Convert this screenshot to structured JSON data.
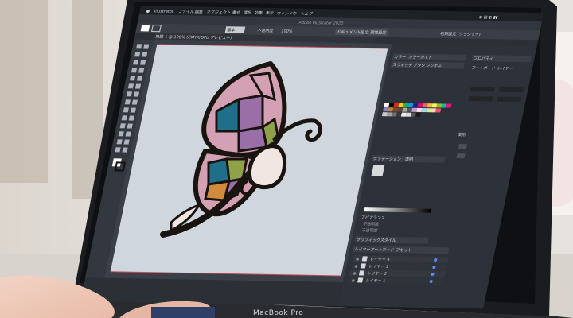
{
  "menubar": {
    "app_name": "Illustrator",
    "items": [
      "ファイル",
      "編集",
      "オブジェクト",
      "書式",
      "選択",
      "効果",
      "表示",
      "ウィンドウ",
      "ヘルプ"
    ]
  },
  "document": {
    "window_title": "Adobe Illustrator 2020",
    "tab_label": "無題-1 @ 100% (CMYK/GPU プレビュー)"
  },
  "control_bar": {
    "style_label": "基本",
    "opacity_label": "不透明度",
    "opacity_value": "100%",
    "doc_setup_button": "ドキュメント設定",
    "prefs_button": "環境設定",
    "workspace_label": "初期設定 (クラシック)"
  },
  "panels": {
    "color_tabs": [
      "カラー",
      "カラーガイド"
    ],
    "swatch_tabs": [
      "スウォッチ",
      "ブラシ",
      "シンボル"
    ],
    "properties_tab": "プロパティ",
    "artboard_tabs": [
      "アートボード",
      "レイヤー"
    ],
    "transform_tab": "変形",
    "gradient_tabs": [
      "グラデーション",
      "透明"
    ],
    "appearance_tab": "アピアランス",
    "appearance_rows": [
      "不透明度",
      "不透明度"
    ],
    "graphic_style_tab": "グラフィックスタイル",
    "layers_tabs": [
      "レイヤー",
      "アートボード",
      "アセット"
    ],
    "layers": [
      "レイヤー 4",
      "レイヤー 3",
      "レイヤー 2",
      "レイヤー 1"
    ]
  },
  "laptop": {
    "model": "MacBook Pro"
  },
  "colors": {
    "ui_dark": "#2b2f36",
    "canvas": "#cfd6dd",
    "butterfly_outline": "#1a1410",
    "butterfly_pink": "#d3a1b3",
    "butterfly_purple": "#9a6fa8",
    "butterfly_teal": "#1f6f8b",
    "butterfly_green": "#8fa24a",
    "butterfly_orange": "#d08a3c",
    "butterfly_cream": "#f1e6e2"
  }
}
